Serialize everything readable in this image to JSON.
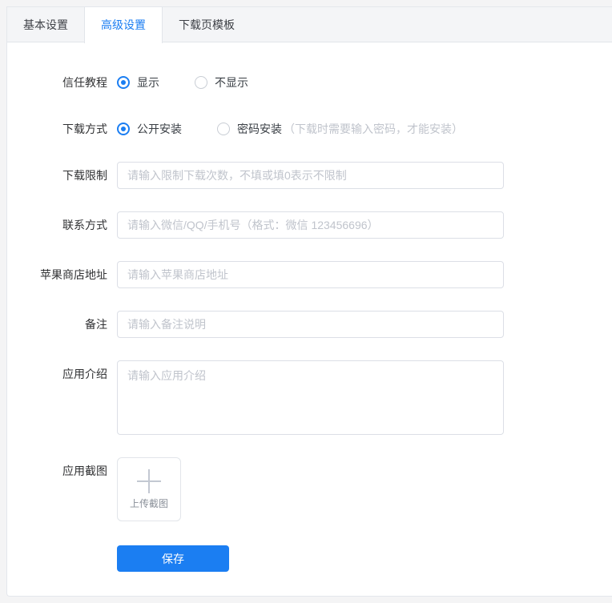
{
  "tabs": [
    {
      "label": "基本设置",
      "active": false
    },
    {
      "label": "高级设置",
      "active": true
    },
    {
      "label": "下载页模板",
      "active": false
    }
  ],
  "form": {
    "trust_tutorial": {
      "label": "信任教程",
      "options": [
        {
          "label": "显示",
          "selected": true
        },
        {
          "label": "不显示",
          "selected": false
        }
      ]
    },
    "download_method": {
      "label": "下载方式",
      "options": [
        {
          "label": "公开安装",
          "selected": true
        },
        {
          "label": "密码安装",
          "selected": false,
          "hint": "（下载时需要输入密码，才能安装）"
        }
      ]
    },
    "download_limit": {
      "label": "下载限制",
      "placeholder": "请输入限制下载次数，不填或填0表示不限制"
    },
    "contact": {
      "label": "联系方式",
      "placeholder": "请输入微信/QQ/手机号（格式：微信 123456696）"
    },
    "apple_store": {
      "label": "苹果商店地址",
      "placeholder": "请输入苹果商店地址"
    },
    "remark": {
      "label": "备注",
      "placeholder": "请输入备注说明"
    },
    "app_intro": {
      "label": "应用介绍",
      "placeholder": "请输入应用介绍"
    },
    "app_screenshot": {
      "label": "应用截图",
      "upload_text": "上传截图"
    },
    "save_label": "保存"
  },
  "colors": {
    "accent": "#1b7ef2",
    "tab_bar_bg": "#f4f5f7",
    "input_border": "#dcdfe6",
    "placeholder": "#c0c4cc"
  }
}
